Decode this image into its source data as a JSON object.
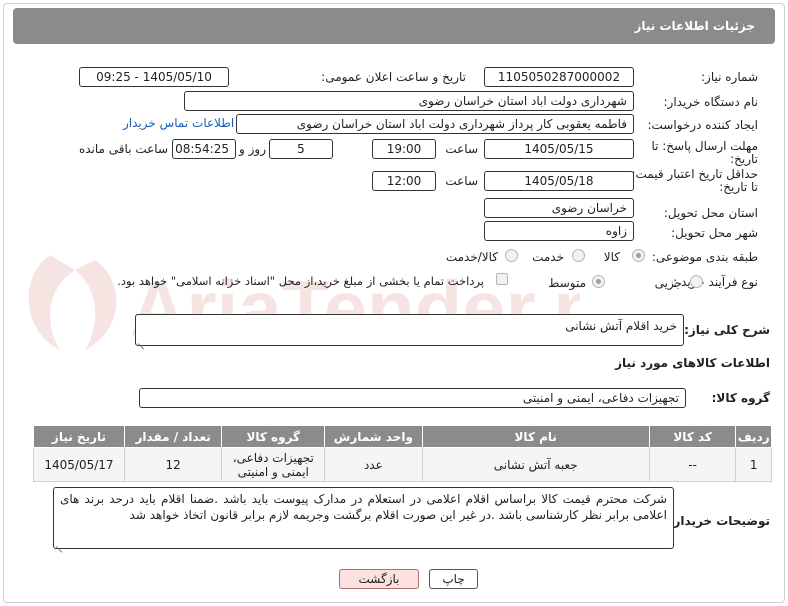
{
  "header": {
    "title": "جزئیات اطلاعات نیاز"
  },
  "fields": {
    "need_number": {
      "label": "شماره نیاز:",
      "value": "1105050287000002"
    },
    "announce": {
      "label": "تاریخ و ساعت اعلان عمومی:",
      "value": "1405/05/10 - 09:25"
    },
    "buyer_org": {
      "label": "نام دستگاه خریدار:",
      "value": "شهرداری دولت اباد استان خراسان رضوی"
    },
    "requester": {
      "label": "ایجاد کننده درخواست:",
      "value": "فاطمه یعقوبی کار پرداز شهرداری دولت اباد استان خراسان رضوی",
      "contact_link": "اطلاعات تماس خریدار"
    },
    "reply_deadline": {
      "label_line1": "مهلت ارسال پاسخ: تا",
      "label_line2": "تاریخ:",
      "date": "1405/05/15",
      "time_label": "ساعت",
      "time": "19:00",
      "days": "5",
      "days_label": "روز و",
      "remaining": "08:54:25",
      "remaining_label": "ساعت باقی مانده"
    },
    "price_validity": {
      "label_line1": "حداقل تاریخ اعتبار قیمت:",
      "label_line2": "تا تاریخ:",
      "date": "1405/05/18",
      "time_label": "ساعت",
      "time": "12:00"
    },
    "delivery_province": {
      "label": "استان محل تحویل:",
      "value": "خراسان رضوی"
    },
    "delivery_city": {
      "label": "شهر محل تحویل:",
      "value": "زاوه"
    },
    "category": {
      "label": "طبقه بندی موضوعی:",
      "options": [
        "کالا",
        "خدمت",
        "کالا/خدمت"
      ],
      "selected": "کالا"
    },
    "purchase_type": {
      "label": "نوع فرآیند خرید :",
      "options": [
        "جزیی",
        "متوسط"
      ],
      "selected": "متوسط",
      "payment_note": "پرداخت تمام یا بخشی از مبلغ خرید،از محل \"اسناد خزانه اسلامی\" خواهد بود."
    }
  },
  "summary": {
    "label": "شرح کلی نیاز:",
    "value": "خرید اقلام آتش نشانی"
  },
  "goods_section": {
    "title": "اطلاعات کالاهای مورد نیاز",
    "group_label": "گروه کالا:",
    "group_value": "تجهیزات دفاعی، ایمنی و امنیتی"
  },
  "table": {
    "headers": [
      "ردیف",
      "کد کالا",
      "نام کالا",
      "واحد شمارش",
      "گروه کالا",
      "تعداد / مقدار",
      "تاریخ نیاز"
    ],
    "rows": [
      {
        "row": "1",
        "code": "--",
        "name": "جعبه آتش نشانی",
        "unit": "عدد",
        "group_line1": "تجهیزات دفاعی،",
        "group_line2": "ایمنی و امنیتی",
        "qty": "12",
        "date": "1405/05/17"
      }
    ]
  },
  "buyer_notes": {
    "label": "توضیحات خریدار:",
    "value": "شرکت محترم قیمت کالا براساس اقلام اعلامی در استعلام در مدارک پیوست باید باشد .ضمنا اقلام باید درحد برند های اعلامی برابر نظر کارشناسی باشد .در غیر این صورت اقلام برگشت وجریمه لازم برابر قانون اتخاذ خواهد شد"
  },
  "buttons": {
    "print": "چاپ",
    "back": "بازگشت"
  },
  "watermark": {
    "text": "AriaTender.net"
  },
  "colors": {
    "header_bg": "#8b8b8b",
    "link": "#1a5fb4",
    "back_button_bg": "#fbe1e1",
    "print_button_bg": "#ffffff"
  }
}
